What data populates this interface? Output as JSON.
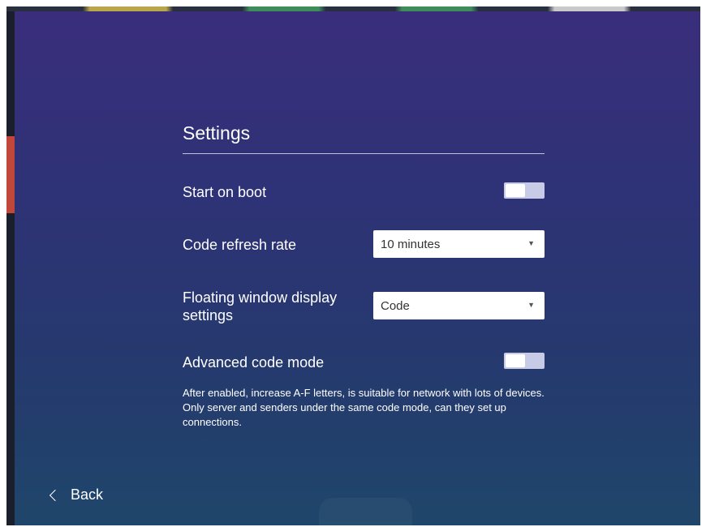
{
  "settings": {
    "title": "Settings",
    "start_on_boot": {
      "label": "Start on boot",
      "enabled": false
    },
    "code_refresh_rate": {
      "label": "Code refresh rate",
      "value": "10 minutes"
    },
    "floating_window": {
      "label": "Floating window display settings",
      "value": "Code"
    },
    "advanced_code_mode": {
      "label": "Advanced code mode",
      "enabled": false,
      "description": "After enabled, increase A-F letters, is suitable for network with lots of devices. Only server and senders under the same code mode, can they set up connections."
    }
  },
  "nav": {
    "back_label": "Back"
  },
  "icons": {
    "back": "chevron-left-icon",
    "dropdown": "caret-down-icon"
  },
  "colors": {
    "toggle_off_track": "#c8cbe6",
    "panel_top": "#3a2e7c",
    "panel_bottom": "#1f466a"
  }
}
